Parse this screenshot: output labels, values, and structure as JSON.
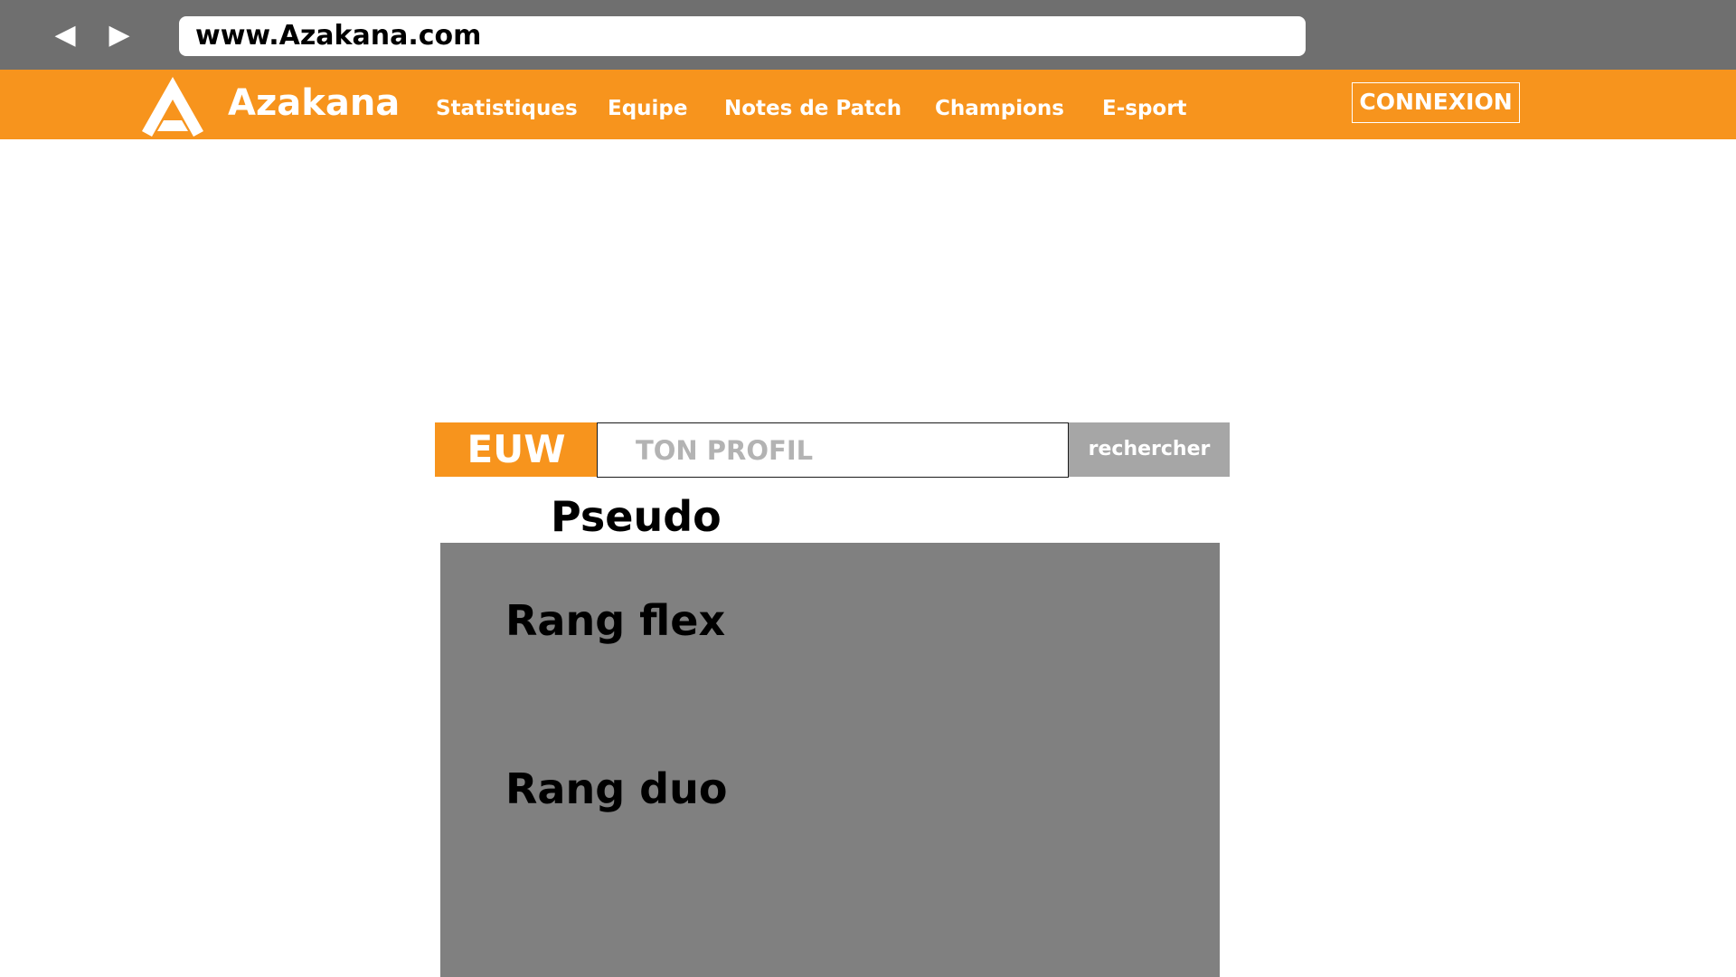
{
  "browser": {
    "back_icon": "back-arrow-icon",
    "forward_icon": "forward-arrow-icon",
    "url": "www.Azakana.com"
  },
  "header": {
    "logo_icon": "azakana-logo-icon",
    "brand": "Azakana",
    "nav": [
      "Statistiques",
      "Equipe",
      "Notes de Patch",
      "Champions",
      "E-sport"
    ],
    "login_label": "CONNEXION",
    "accent_color": "#f7941d"
  },
  "search": {
    "region": "EUW",
    "placeholder": "TON PROFIL",
    "value": "",
    "button_label": "rechercher"
  },
  "profile": {
    "pseudo": "Pseudo",
    "rank_flex": "Rang flex",
    "rank_duo": "Rang duo",
    "panel_color": "#808080"
  }
}
